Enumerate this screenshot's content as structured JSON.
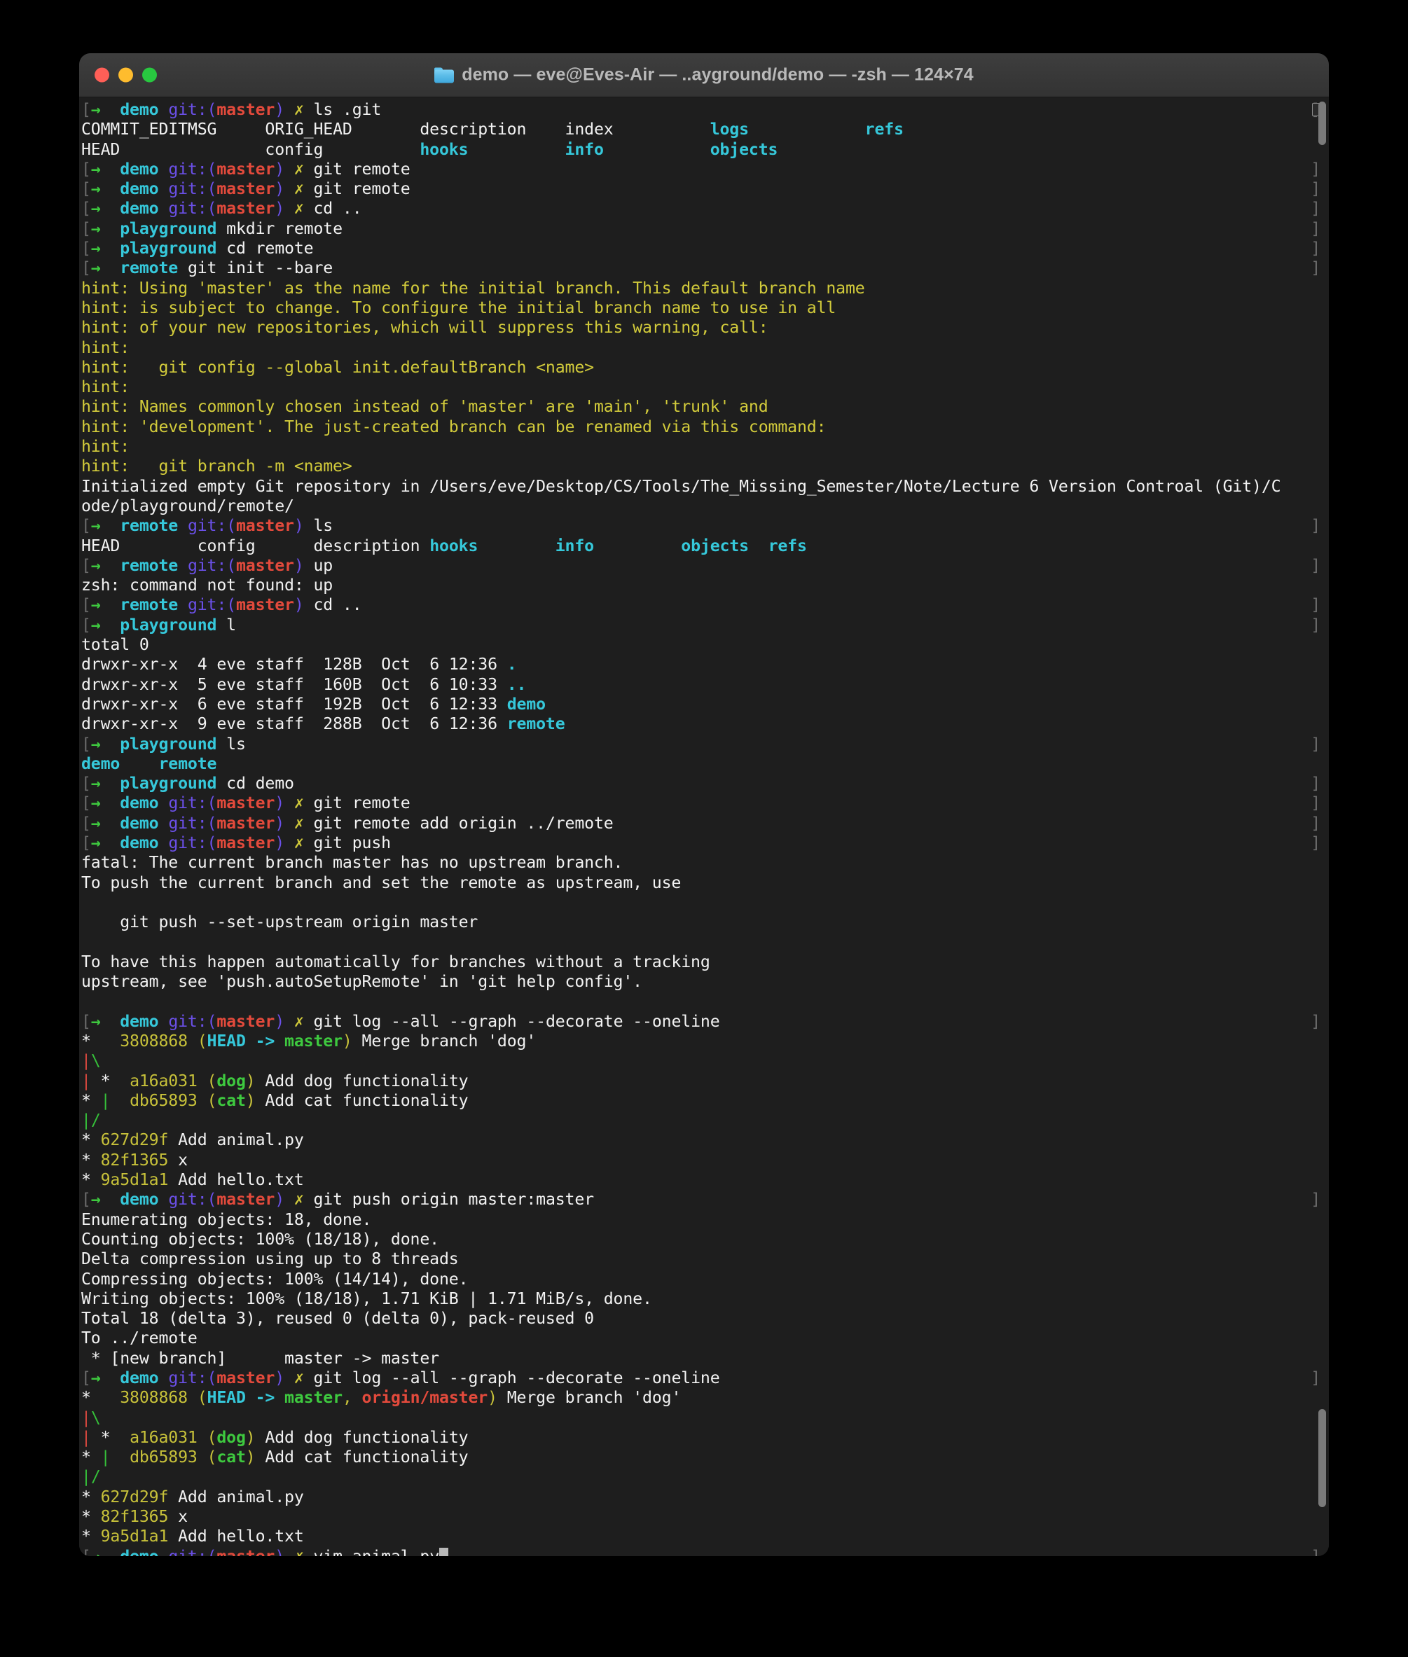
{
  "window": {
    "title": "demo — eve@Eves-Air — ..ayground/demo — -zsh — 124×74",
    "folder_icon": "folder-icon",
    "controls": {
      "close": "close",
      "minimize": "minimize",
      "maximize": "maximize"
    }
  },
  "terminal": {
    "shell": "-zsh",
    "size": "124×74",
    "user_host": "eve@Eves-Air",
    "cwd_short": "..ayground/demo",
    "prompt": {
      "bracket": "[",
      "arrow": "→",
      "git_prefix": "git:(",
      "git_suffix": ")",
      "dirty_mark": "✗",
      "edge_mark": "]"
    },
    "lines": [
      {
        "type": "prompt",
        "dir": "demo",
        "branch": "master",
        "dirty": true,
        "cmd": "ls .git"
      },
      {
        "type": "cols",
        "cells": [
          {
            "t": "COMMIT_EDITMSG",
            "c": "fg-white",
            "w": 19
          },
          {
            "t": "ORIG_HEAD",
            "c": "fg-white",
            "w": 16
          },
          {
            "t": "description",
            "c": "fg-white",
            "w": 15
          },
          {
            "t": "index",
            "c": "fg-white",
            "w": 15
          },
          {
            "t": "logs",
            "c": "fg-cyanb",
            "w": 16
          },
          {
            "t": "refs",
            "c": "fg-cyanb",
            "w": 8
          }
        ]
      },
      {
        "type": "cols",
        "cells": [
          {
            "t": "HEAD",
            "c": "fg-white",
            "w": 19
          },
          {
            "t": "config",
            "c": "fg-white",
            "w": 16
          },
          {
            "t": "hooks",
            "c": "fg-cyanb",
            "w": 15
          },
          {
            "t": "info",
            "c": "fg-cyanb",
            "w": 15
          },
          {
            "t": "objects",
            "c": "fg-cyanb",
            "w": 16
          },
          {
            "t": "",
            "c": "fg-white",
            "w": 8
          }
        ]
      },
      {
        "type": "prompt",
        "dir": "demo",
        "branch": "master",
        "dirty": true,
        "cmd": "git remote"
      },
      {
        "type": "prompt",
        "dir": "demo",
        "branch": "master",
        "dirty": true,
        "cmd": "git remote"
      },
      {
        "type": "prompt",
        "dir": "demo",
        "branch": "master",
        "dirty": true,
        "cmd": "cd .."
      },
      {
        "type": "prompt",
        "dir": "playground",
        "branch": null,
        "dirty": false,
        "cmd": "mkdir remote"
      },
      {
        "type": "prompt",
        "dir": "playground",
        "branch": null,
        "dirty": false,
        "cmd": "cd remote"
      },
      {
        "type": "prompt",
        "dir": "remote",
        "branch": null,
        "dirty": false,
        "cmd": "git init --bare"
      },
      {
        "type": "out",
        "c": "fg-yellow",
        "t": "hint: Using 'master' as the name for the initial branch. This default branch name"
      },
      {
        "type": "out",
        "c": "fg-yellow",
        "t": "hint: is subject to change. To configure the initial branch name to use in all"
      },
      {
        "type": "out",
        "c": "fg-yellow",
        "t": "hint: of your new repositories, which will suppress this warning, call:"
      },
      {
        "type": "out",
        "c": "fg-yellow",
        "t": "hint:"
      },
      {
        "type": "out",
        "c": "fg-yellow",
        "t": "hint:   git config --global init.defaultBranch <name>"
      },
      {
        "type": "out",
        "c": "fg-yellow",
        "t": "hint:"
      },
      {
        "type": "out",
        "c": "fg-yellow",
        "t": "hint: Names commonly chosen instead of 'master' are 'main', 'trunk' and"
      },
      {
        "type": "out",
        "c": "fg-yellow",
        "t": "hint: 'development'. The just-created branch can be renamed via this command:"
      },
      {
        "type": "out",
        "c": "fg-yellow",
        "t": "hint:"
      },
      {
        "type": "out",
        "c": "fg-yellow",
        "t": "hint:   git branch -m <name>"
      },
      {
        "type": "out",
        "c": "fg-white",
        "t": "Initialized empty Git repository in /Users/eve/Desktop/CS/Tools/The_Missing_Semester/Note/Lecture 6 Version Controal (Git)/C"
      },
      {
        "type": "out",
        "c": "fg-white",
        "t": "ode/playground/remote/"
      },
      {
        "type": "prompt",
        "dir": "remote",
        "branch": "master",
        "dirty": false,
        "cmd": "ls"
      },
      {
        "type": "cols",
        "cells": [
          {
            "t": "HEAD",
            "c": "fg-white",
            "w": 12
          },
          {
            "t": "config",
            "c": "fg-white",
            "w": 12
          },
          {
            "t": "description",
            "c": "fg-white",
            "w": 12
          },
          {
            "t": "hooks",
            "c": "fg-cyanb",
            "w": 13
          },
          {
            "t": "info",
            "c": "fg-cyanb",
            "w": 13
          },
          {
            "t": "objects",
            "c": "fg-cyanb",
            "w": 9
          },
          {
            "t": "refs",
            "c": "fg-cyanb",
            "w": 6
          }
        ]
      },
      {
        "type": "prompt",
        "dir": "remote",
        "branch": "master",
        "dirty": false,
        "cmd": "up"
      },
      {
        "type": "out",
        "c": "fg-white",
        "t": "zsh: command not found: up"
      },
      {
        "type": "prompt",
        "dir": "remote",
        "branch": "master",
        "dirty": false,
        "cmd": "cd .."
      },
      {
        "type": "prompt",
        "dir": "playground",
        "branch": null,
        "dirty": false,
        "cmd": "l"
      },
      {
        "type": "out",
        "c": "fg-white",
        "t": "total 0"
      },
      {
        "type": "ls",
        "perm": "drwxr-xr-x",
        "links": "4",
        "user": "eve",
        "group": "staff",
        "size": "128B",
        "date": "Oct  6 12:36",
        "name": ".",
        "namec": "fg-cyanb"
      },
      {
        "type": "ls",
        "perm": "drwxr-xr-x",
        "links": "5",
        "user": "eve",
        "group": "staff",
        "size": "160B",
        "date": "Oct  6 10:33",
        "name": "..",
        "namec": "fg-cyanb"
      },
      {
        "type": "ls",
        "perm": "drwxr-xr-x",
        "links": "6",
        "user": "eve",
        "group": "staff",
        "size": "192B",
        "date": "Oct  6 12:33",
        "name": "demo",
        "namec": "fg-cyanb"
      },
      {
        "type": "ls",
        "perm": "drwxr-xr-x",
        "links": "9",
        "user": "eve",
        "group": "staff",
        "size": "288B",
        "date": "Oct  6 12:36",
        "name": "remote",
        "namec": "fg-cyanb"
      },
      {
        "type": "prompt",
        "dir": "playground",
        "branch": null,
        "dirty": false,
        "cmd": "ls"
      },
      {
        "type": "cols",
        "cells": [
          {
            "t": "demo",
            "c": "fg-cyanb",
            "w": 8
          },
          {
            "t": "remote",
            "c": "fg-cyanb",
            "w": 8
          }
        ]
      },
      {
        "type": "prompt",
        "dir": "playground",
        "branch": null,
        "dirty": false,
        "cmd": "cd demo"
      },
      {
        "type": "prompt",
        "dir": "demo",
        "branch": "master",
        "dirty": true,
        "cmd": "git remote"
      },
      {
        "type": "prompt",
        "dir": "demo",
        "branch": "master",
        "dirty": true,
        "cmd": "git remote add origin ../remote"
      },
      {
        "type": "prompt",
        "dir": "demo",
        "branch": "master",
        "dirty": true,
        "cmd": "git push"
      },
      {
        "type": "out",
        "c": "fg-white",
        "t": "fatal: The current branch master has no upstream branch."
      },
      {
        "type": "out",
        "c": "fg-white",
        "t": "To push the current branch and set the remote as upstream, use"
      },
      {
        "type": "out",
        "c": "fg-white",
        "t": ""
      },
      {
        "type": "out",
        "c": "fg-white",
        "t": "    git push --set-upstream origin master"
      },
      {
        "type": "out",
        "c": "fg-white",
        "t": ""
      },
      {
        "type": "out",
        "c": "fg-white",
        "t": "To have this happen automatically for branches without a tracking"
      },
      {
        "type": "out",
        "c": "fg-white",
        "t": "upstream, see 'push.autoSetupRemote' in 'git help config'."
      },
      {
        "type": "out",
        "c": "fg-white",
        "t": ""
      },
      {
        "type": "prompt",
        "dir": "demo",
        "branch": "master",
        "dirty": true,
        "cmd": "git log --all --graph --decorate --oneline"
      },
      {
        "type": "log",
        "graph": [
          {
            "t": "*",
            "c": "fg-white"
          }
        ],
        "indent": "  ",
        "hash": "3808868",
        "refs": [
          {
            "t": "(",
            "c": "fg-olive"
          },
          {
            "t": "HEAD",
            "c": "fg-cyanb"
          },
          {
            "t": " -> ",
            "c": "fg-cyanb"
          },
          {
            "t": "master",
            "c": "fg-greenb"
          },
          {
            "t": ")",
            "c": "fg-olive"
          }
        ],
        "msg": "Merge branch 'dog'"
      },
      {
        "type": "graph",
        "parts": [
          {
            "t": "|",
            "c": "fg-red"
          },
          {
            "t": "\\",
            "c": "fg-green"
          }
        ]
      },
      {
        "type": "log",
        "graph": [
          {
            "t": "|",
            "c": "fg-red"
          },
          {
            "t": " ",
            "c": "fg-white"
          },
          {
            "t": "*",
            "c": "fg-white"
          }
        ],
        "indent": " ",
        "hash": "a16a031",
        "refs": [
          {
            "t": "(",
            "c": "fg-olive"
          },
          {
            "t": "dog",
            "c": "fg-greenb"
          },
          {
            "t": ")",
            "c": "fg-olive"
          }
        ],
        "msg": "Add dog functionality"
      },
      {
        "type": "log",
        "graph": [
          {
            "t": "*",
            "c": "fg-white"
          },
          {
            "t": " ",
            "c": "fg-white"
          },
          {
            "t": "|",
            "c": "fg-green"
          }
        ],
        "indent": " ",
        "hash": "db65893",
        "refs": [
          {
            "t": "(",
            "c": "fg-olive"
          },
          {
            "t": "cat",
            "c": "fg-greenb"
          },
          {
            "t": ")",
            "c": "fg-olive"
          }
        ],
        "msg": "Add cat functionality"
      },
      {
        "type": "graph",
        "parts": [
          {
            "t": "|",
            "c": "fg-green"
          },
          {
            "t": "/",
            "c": "fg-green"
          }
        ]
      },
      {
        "type": "log",
        "graph": [
          {
            "t": "*",
            "c": "fg-white"
          }
        ],
        "indent": "",
        "hash": "627d29f",
        "refs": [],
        "msg": "Add animal.py"
      },
      {
        "type": "log",
        "graph": [
          {
            "t": "*",
            "c": "fg-white"
          }
        ],
        "indent": "",
        "hash": "82f1365",
        "refs": [],
        "msg": "x"
      },
      {
        "type": "log",
        "graph": [
          {
            "t": "*",
            "c": "fg-white"
          }
        ],
        "indent": "",
        "hash": "9a5d1a1",
        "refs": [],
        "msg": "Add hello.txt"
      },
      {
        "type": "prompt",
        "dir": "demo",
        "branch": "master",
        "dirty": true,
        "cmd": "git push origin master:master"
      },
      {
        "type": "out",
        "c": "fg-white",
        "t": "Enumerating objects: 18, done."
      },
      {
        "type": "out",
        "c": "fg-white",
        "t": "Counting objects: 100% (18/18), done."
      },
      {
        "type": "out",
        "c": "fg-white",
        "t": "Delta compression using up to 8 threads"
      },
      {
        "type": "out",
        "c": "fg-white",
        "t": "Compressing objects: 100% (14/14), done."
      },
      {
        "type": "out",
        "c": "fg-white",
        "t": "Writing objects: 100% (18/18), 1.71 KiB | 1.71 MiB/s, done."
      },
      {
        "type": "out",
        "c": "fg-white",
        "t": "Total 18 (delta 3), reused 0 (delta 0), pack-reused 0"
      },
      {
        "type": "out",
        "c": "fg-white",
        "t": "To ../remote"
      },
      {
        "type": "out",
        "c": "fg-white",
        "t": " * [new branch]      master -> master"
      },
      {
        "type": "prompt",
        "dir": "demo",
        "branch": "master",
        "dirty": true,
        "cmd": "git log --all --graph --decorate --oneline"
      },
      {
        "type": "log",
        "graph": [
          {
            "t": "*",
            "c": "fg-white"
          }
        ],
        "indent": "  ",
        "hash": "3808868",
        "refs": [
          {
            "t": "(",
            "c": "fg-olive"
          },
          {
            "t": "HEAD",
            "c": "fg-cyanb"
          },
          {
            "t": " -> ",
            "c": "fg-cyanb"
          },
          {
            "t": "master",
            "c": "fg-greenb"
          },
          {
            "t": ", ",
            "c": "fg-olive"
          },
          {
            "t": "origin/master",
            "c": "fg-redb"
          },
          {
            "t": ")",
            "c": "fg-olive"
          }
        ],
        "msg": "Merge branch 'dog'"
      },
      {
        "type": "graph",
        "parts": [
          {
            "t": "|",
            "c": "fg-red"
          },
          {
            "t": "\\",
            "c": "fg-green"
          }
        ]
      },
      {
        "type": "log",
        "graph": [
          {
            "t": "|",
            "c": "fg-red"
          },
          {
            "t": " ",
            "c": "fg-white"
          },
          {
            "t": "*",
            "c": "fg-white"
          }
        ],
        "indent": " ",
        "hash": "a16a031",
        "refs": [
          {
            "t": "(",
            "c": "fg-olive"
          },
          {
            "t": "dog",
            "c": "fg-greenb"
          },
          {
            "t": ")",
            "c": "fg-olive"
          }
        ],
        "msg": "Add dog functionality"
      },
      {
        "type": "log",
        "graph": [
          {
            "t": "*",
            "c": "fg-white"
          },
          {
            "t": " ",
            "c": "fg-white"
          },
          {
            "t": "|",
            "c": "fg-green"
          }
        ],
        "indent": " ",
        "hash": "db65893",
        "refs": [
          {
            "t": "(",
            "c": "fg-olive"
          },
          {
            "t": "cat",
            "c": "fg-greenb"
          },
          {
            "t": ")",
            "c": "fg-olive"
          }
        ],
        "msg": "Add cat functionality"
      },
      {
        "type": "graph",
        "parts": [
          {
            "t": "|",
            "c": "fg-green"
          },
          {
            "t": "/",
            "c": "fg-green"
          }
        ]
      },
      {
        "type": "log",
        "graph": [
          {
            "t": "*",
            "c": "fg-white"
          }
        ],
        "indent": "",
        "hash": "627d29f",
        "refs": [],
        "msg": "Add animal.py"
      },
      {
        "type": "log",
        "graph": [
          {
            "t": "*",
            "c": "fg-white"
          }
        ],
        "indent": "",
        "hash": "82f1365",
        "refs": [],
        "msg": "x"
      },
      {
        "type": "log",
        "graph": [
          {
            "t": "*",
            "c": "fg-white"
          }
        ],
        "indent": "",
        "hash": "9a5d1a1",
        "refs": [],
        "msg": "Add hello.txt"
      },
      {
        "type": "prompt",
        "dir": "demo",
        "branch": "master",
        "dirty": true,
        "cmd": "vim animal.py",
        "cursor": true
      }
    ]
  },
  "colors": {
    "background": "#1e1e1e",
    "titlebar": "#383838",
    "foreground": "#e6e6e6",
    "cyan": "#2bc4d6",
    "green": "#36c13a",
    "red": "#d9483f",
    "yellow": "#d2cb3b",
    "purple": "#6b50e8",
    "close": "#ff5f57",
    "minimize": "#febc2e",
    "maximize": "#28c840"
  }
}
